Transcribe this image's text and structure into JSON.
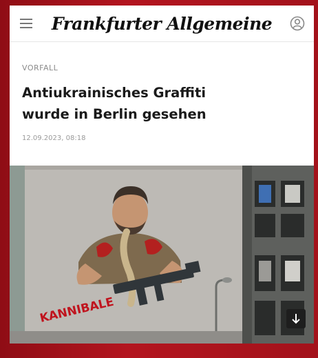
{
  "app": {
    "brand_name": "Frankfurter Allgemeine"
  },
  "header": {
    "menu_icon": "hamburger-icon",
    "account_icon": "user-icon"
  },
  "article": {
    "kicker": "VORFALL",
    "headline_line1": "Antiukrainisches Graffiti",
    "headline_line2": "wurde in Berlin gesehen",
    "dateline": "12.09.2023, 08:18"
  },
  "image": {
    "graffiti_text": "KANNIBALE",
    "scroll_icon": "arrow-down-icon"
  },
  "colors": {
    "frame": "#a3121b",
    "accent_red": "#c0141e",
    "text_dark": "#1a1a1a",
    "text_muted": "#8a8a8a"
  }
}
